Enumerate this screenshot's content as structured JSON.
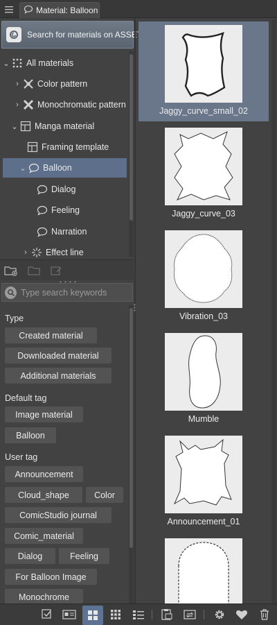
{
  "tab": {
    "title": "Material: Balloon"
  },
  "assets": {
    "label": "Search for materials on ASSETS"
  },
  "tree": {
    "items": [
      {
        "label": "All materials"
      },
      {
        "label": "Color pattern"
      },
      {
        "label": "Monochromatic pattern"
      },
      {
        "label": "Manga material"
      },
      {
        "label": "Framing template"
      },
      {
        "label": "Balloon"
      },
      {
        "label": "Dialog"
      },
      {
        "label": "Feeling"
      },
      {
        "label": "Narration"
      },
      {
        "label": "Effect line"
      }
    ]
  },
  "search": {
    "placeholder": "Type search keywords"
  },
  "tags": {
    "type_heading": "Type",
    "type": [
      "Created material",
      "Downloaded material",
      "Additional materials"
    ],
    "default_heading": "Default tag",
    "default": [
      "Image material",
      "Balloon"
    ],
    "user_heading": "User tag",
    "user": [
      "Announcement",
      "Cloud_shape",
      "Color",
      "ComicStudio journal",
      "Comic_material",
      "Dialog",
      "Feeling",
      "For Balloon Image",
      "Monochrome"
    ]
  },
  "materials": [
    {
      "label": "Jaggy_curve_small_02",
      "selected": true
    },
    {
      "label": "Jaggy_curve_03"
    },
    {
      "label": "Vibration_03"
    },
    {
      "label": "Mumble"
    },
    {
      "label": "Announcement_01"
    },
    {
      "label": ""
    }
  ],
  "colors": {
    "selection": "#6a7689",
    "accent": "#5d7394",
    "panel": "#424242"
  }
}
